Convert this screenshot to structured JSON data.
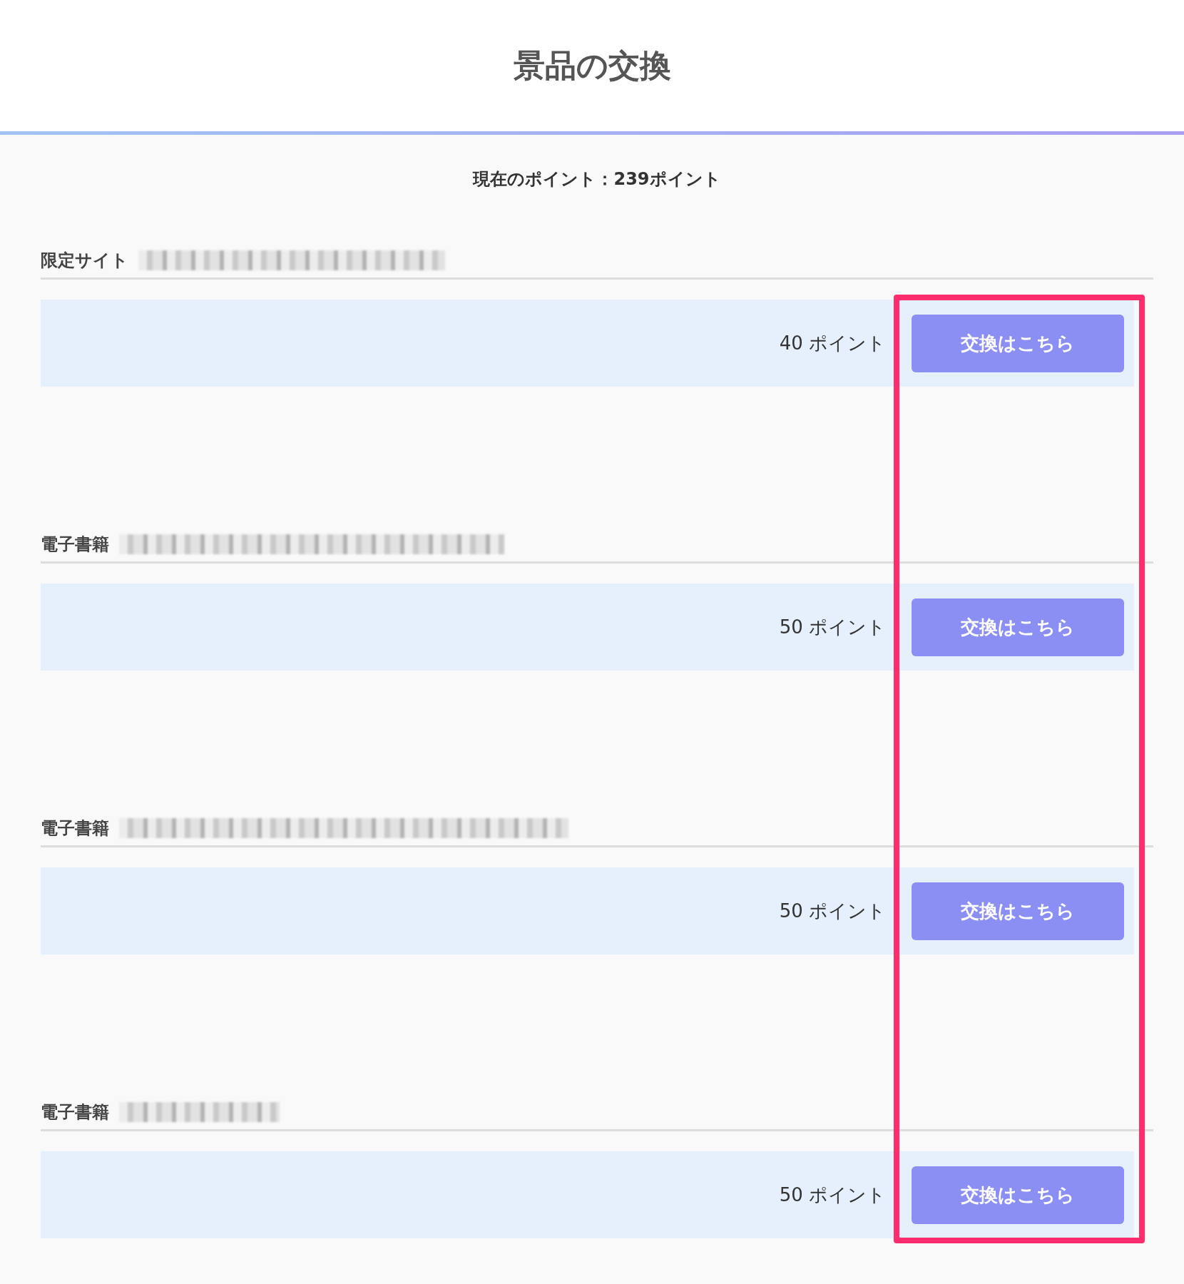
{
  "header": {
    "title": "景品の交換"
  },
  "points_summary": "現在のポイント：239ポイント",
  "prizes": [
    {
      "category": "限定サイト",
      "redacted": true,
      "price": "40 ポイント",
      "button": "交換はこちら"
    },
    {
      "category": "電子書籍",
      "redacted": true,
      "price": "50 ポイント",
      "button": "交換はこちら"
    },
    {
      "category": "電子書籍",
      "redacted": true,
      "price": "50 ポイント",
      "button": "交換はこちら"
    },
    {
      "category": "電子書籍",
      "redacted": true,
      "price": "50 ポイント",
      "button": "交換はこちら"
    }
  ],
  "highlight": {
    "color": "#ff2d6e"
  }
}
